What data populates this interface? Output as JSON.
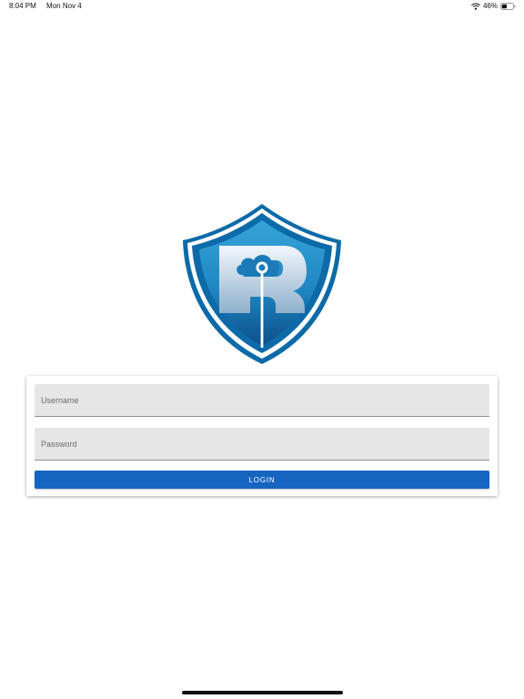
{
  "status_bar": {
    "time": "8:04 PM",
    "date": "Mon Nov 4",
    "battery_percent": "46%",
    "battery_level": 0.46,
    "icons": [
      "wifi-icon",
      "battery-icon"
    ]
  },
  "logo": {
    "letter": "R",
    "icons": [
      "shield-icon",
      "cloud-icon"
    ],
    "colors": {
      "outer_blue": "#0d6aa8",
      "inner_blue": "#1f8fcb",
      "dark_blue": "#0a3f78",
      "letter_fill": "#d6e3ee"
    }
  },
  "login_form": {
    "username": {
      "placeholder": "Username",
      "value": ""
    },
    "password": {
      "placeholder": "Password",
      "value": ""
    },
    "login_label": "LOGIN",
    "accent_color": "#1565c0"
  }
}
